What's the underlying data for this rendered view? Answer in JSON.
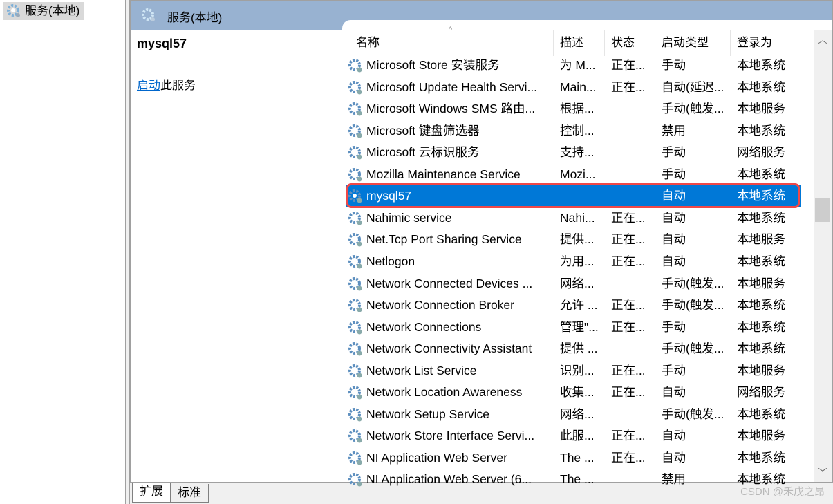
{
  "tree": {
    "item": "服务(本地)"
  },
  "header": {
    "title": "服务(本地)"
  },
  "details": {
    "service_name": "mysql57",
    "action_link": "启动",
    "action_suffix": "此服务"
  },
  "columns": [
    "名称",
    "描述",
    "状态",
    "启动类型",
    "登录为"
  ],
  "rows": [
    [
      "Microsoft Store 安装服务",
      "为 M...",
      "正在...",
      "手动",
      "本地系统"
    ],
    [
      "Microsoft Update Health Servi...",
      "Main...",
      "正在...",
      "自动(延迟...",
      "本地系统"
    ],
    [
      "Microsoft Windows SMS 路由...",
      "根据...",
      "",
      "手动(触发...",
      "本地服务"
    ],
    [
      "Microsoft 键盘筛选器",
      "控制...",
      "",
      "禁用",
      "本地系统"
    ],
    [
      "Microsoft 云标识服务",
      "支持...",
      "",
      "手动",
      "网络服务"
    ],
    [
      "Mozilla Maintenance Service",
      "Mozi...",
      "",
      "手动",
      "本地系统"
    ],
    [
      "mysql57",
      "",
      "",
      "自动",
      "本地系统"
    ],
    [
      "Nahimic service",
      "Nahi...",
      "正在...",
      "自动",
      "本地系统"
    ],
    [
      "Net.Tcp Port Sharing Service",
      "提供...",
      "正在...",
      "自动",
      "本地服务"
    ],
    [
      "Netlogon",
      "为用...",
      "正在...",
      "自动",
      "本地系统"
    ],
    [
      "Network Connected Devices ...",
      "网络...",
      "",
      "手动(触发...",
      "本地服务"
    ],
    [
      "Network Connection Broker",
      "允许 ...",
      "正在...",
      "手动(触发...",
      "本地系统"
    ],
    [
      "Network Connections",
      "管理\"...",
      "正在...",
      "手动",
      "本地系统"
    ],
    [
      "Network Connectivity Assistant",
      "提供 ...",
      "",
      "手动(触发...",
      "本地系统"
    ],
    [
      "Network List Service",
      "识别...",
      "正在...",
      "手动",
      "本地服务"
    ],
    [
      "Network Location Awareness",
      "收集...",
      "正在...",
      "自动",
      "网络服务"
    ],
    [
      "Network Setup Service",
      "网络...",
      "",
      "手动(触发...",
      "本地系统"
    ],
    [
      "Network Store Interface Servi...",
      "此服...",
      "正在...",
      "自动",
      "本地服务"
    ],
    [
      "NI Application Web Server",
      "The ...",
      "正在...",
      "自动",
      "本地系统"
    ],
    [
      "NI Application Web Server (6...",
      "The ...",
      "",
      "禁用",
      "本地系统"
    ]
  ],
  "selected_index": 6,
  "tabs": [
    "扩展",
    "标准"
  ],
  "watermark": "CSDN @禾戊之昂",
  "colors": {
    "header_band": "#98b2d1",
    "selection": "#0078d7",
    "highlight_box": "#f04848",
    "link": "#0066cc"
  }
}
